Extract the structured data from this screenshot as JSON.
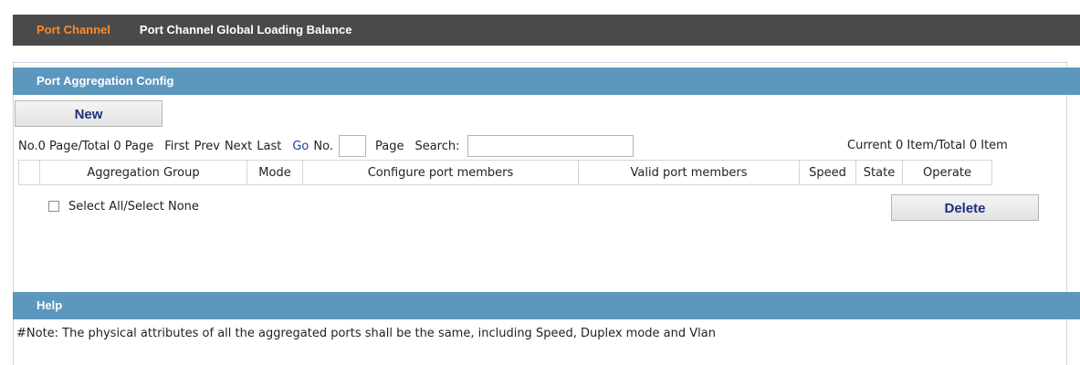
{
  "tabs": [
    {
      "label": "Port Channel",
      "active": true
    },
    {
      "label": "Port Channel Global Loading Balance",
      "active": false
    }
  ],
  "config": {
    "title": "Port Aggregation Config",
    "new_button": "New",
    "pager": {
      "status": "No.0 Page/Total 0 Page",
      "first": "First",
      "prev": "Prev",
      "next": "Next",
      "last": "Last",
      "go": "Go",
      "no_label": "No.",
      "page_value": "",
      "page_label": "Page",
      "search_label": "Search:",
      "search_value": ""
    },
    "item_count": "Current 0 Item/Total 0 Item",
    "columns": [
      "",
      "Aggregation Group",
      "Mode",
      "Configure port members",
      "Valid port members",
      "Speed",
      "State",
      "Operate"
    ],
    "rows": [],
    "select_all_label": "Select All/Select None",
    "delete_button": "Delete"
  },
  "help": {
    "title": "Help",
    "note": "#Note: The physical attributes of all the aggregated ports shall be the same, including Speed, Duplex mode and Vlan"
  },
  "colors": {
    "tab_bar": "#4a4a4a",
    "tab_active": "#ff8a2a",
    "section_header": "#5c97bd",
    "button_text": "#1e2f80",
    "link": "#1c3fb0"
  }
}
